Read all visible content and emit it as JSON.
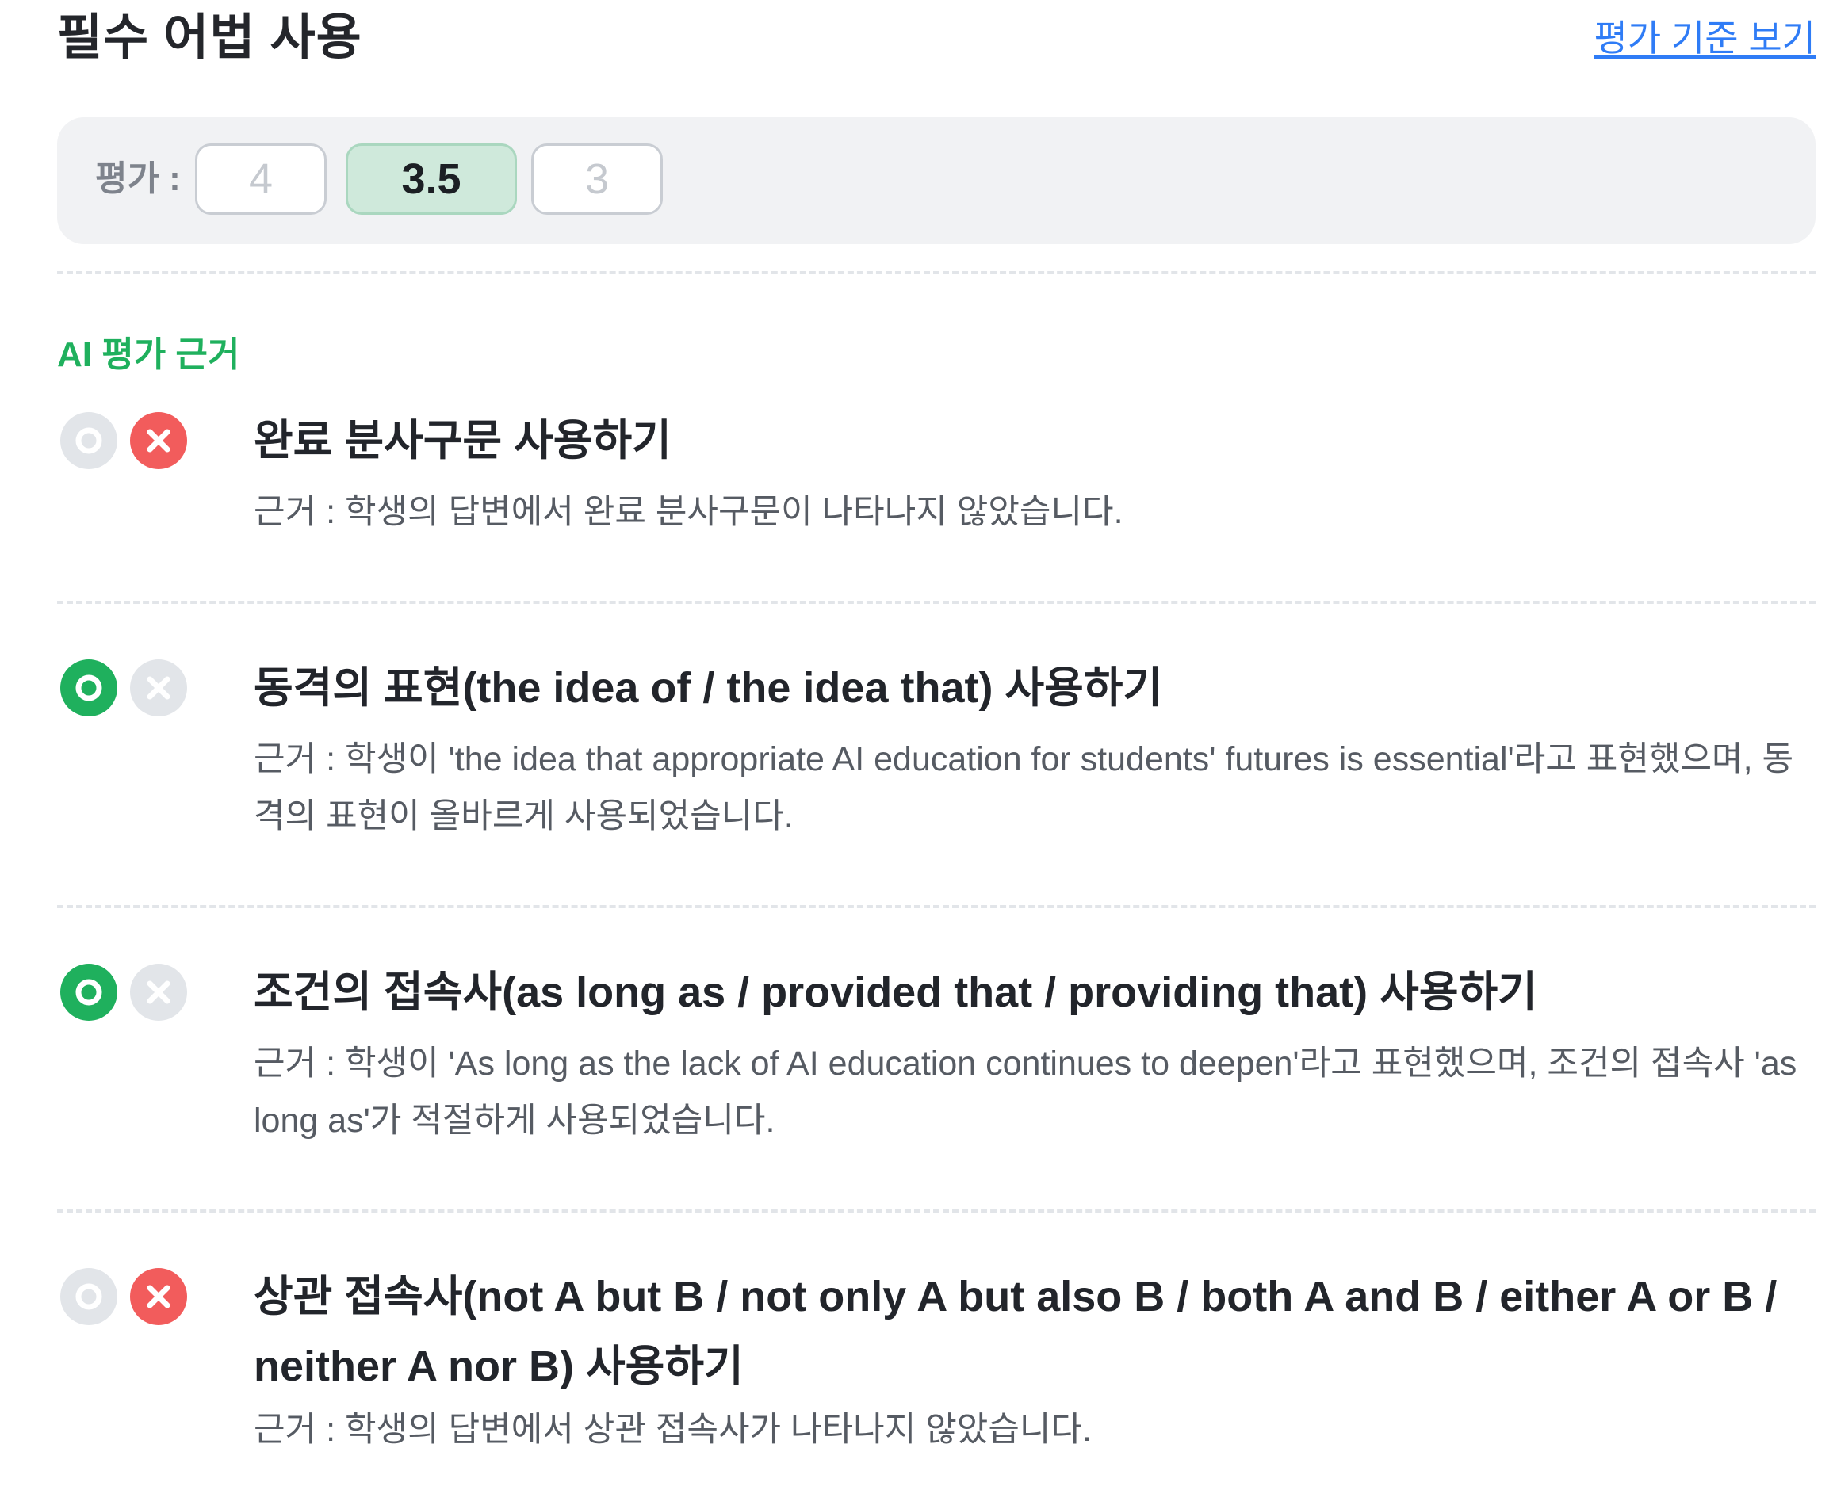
{
  "header": {
    "title": "필수 어법 사용",
    "criteria_link": "평가 기준 보기"
  },
  "rating": {
    "label": "평가 :",
    "options": [
      "4",
      "3.5",
      "3"
    ],
    "selected": "3.5"
  },
  "section": {
    "label": "AI 평가 근거"
  },
  "items": [
    {
      "result": "fail",
      "title": "완료 분사구문 사용하기",
      "reason": "근거 : 학생의 답변에서 완료 분사구문이 나타나지 않았습니다."
    },
    {
      "result": "pass",
      "title": "동격의 표현(the idea of / the idea that) 사용하기",
      "reason": "근거 : 학생이 'the idea that appropriate AI education for students' futures is essential'라고 표현했으며, 동격의 표현이 올바르게 사용되었습니다."
    },
    {
      "result": "pass",
      "title": "조건의 접속사(as long as / provided that / providing that) 사용하기",
      "reason": "근거 : 학생이 'As long as the lack of AI education continues to deepen'라고 표현했으며, 조건의 접속사 'as long as'가 적절하게 사용되었습니다."
    },
    {
      "result": "fail",
      "title": "상관 접속사(not A but B / not only A but also B / both A and B / either A or B / neither A nor B) 사용하기",
      "reason": "근거 : 학생의 답변에서 상관 접속사가 나타나지 않았습니다."
    }
  ],
  "colors": {
    "pass": "#1fb05d",
    "fail": "#f25c5c",
    "inactive": "#e2e5e9",
    "link": "#2f7cf6",
    "selected_bg": "#cfe9db"
  },
  "icons": {
    "pass": "circle-check-icon",
    "fail": "x-circle-icon"
  }
}
